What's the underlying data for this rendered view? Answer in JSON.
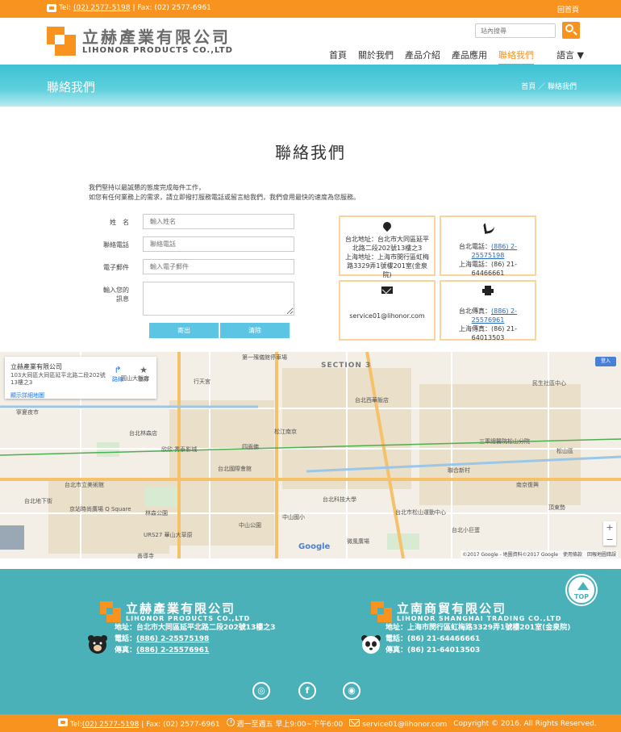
{
  "topbar": {
    "tel_label": "Tel:",
    "tel": "(02) 2577-5198",
    "fax": "| Fax: (02) 2577-6961",
    "home_link": "回首頁"
  },
  "header": {
    "logo_cn": "立赫產業有限公司",
    "logo_en": "LIHONOR PRODUCTS CO.,LTD",
    "search_placeholder": "站內搜尋",
    "nav": [
      "首頁",
      "關於我們",
      "產品介紹",
      "產品應用",
      "聯絡我們"
    ],
    "active_nav": "聯絡我們",
    "lang": "語言 ▼"
  },
  "banner": {
    "title": "聯絡我們",
    "breadcrumb": "首頁 ／ 聯絡我們"
  },
  "main": {
    "heading": "聯絡我們",
    "intro_line1": "我們堅持以最誠懇的態度完成每件工作，",
    "intro_line2": "如您有任何業務上的需求，請立即撥打服務電話或留言給我們，我們會用最快的速度為您服務。"
  },
  "form": {
    "name_label": "姓　名",
    "name_placeholder": "輸入姓名",
    "phone_label": "聯絡電話",
    "phone_placeholder": "聯絡電話",
    "email_label": "電子郵件",
    "email_placeholder": "輸入電子郵件",
    "message_label_1": "輸入您的",
    "message_label_2": "訊息",
    "submit_label": "寄出",
    "clear_label": "清除"
  },
  "info": {
    "address_1": "台北地址：台北市大同區延平北路二段202號13樓之3",
    "address_2": "上海地址：上海市閔行區虹梅路3329弄1號樓201室(金泉院)",
    "phone_taipei_label": "台北電話：",
    "phone_taipei": "(886) 2-25575198",
    "phone_shanghai": "上海電話：(86) 21-64466661",
    "email": "service01@lihonor.com",
    "fax_taipei_label": "台北傳真：",
    "fax_taipei": "(886) 2-25576961",
    "fax_shanghai": "上海傳真：(86) 21-64013503"
  },
  "map": {
    "place_name": "立赫產業有限公司",
    "place_address": "103大同區大同區延平北路二段202號13樓之3",
    "directions": "路線",
    "save": "儲存",
    "larger_map": "顯示詳細地圖",
    "section": "SECTION 3",
    "badge": "登入",
    "copyright": "©2017 Google - 地圖資料©2017 Google　使用條款　回報地圖錯誤",
    "labels": [
      "第一殯儀館停車場",
      "台北西華飯店",
      "民生社區中心",
      "松山區",
      "聯合新村",
      "台北市立美術館",
      "圓山大飯店",
      "台北林森店",
      "欣欣·秀泰影城",
      "四面佛",
      "松江南京",
      "台北國際會館",
      "林森公園",
      "中山國小",
      "京站時尚廣場 Q Square",
      "URS27 華山大草原",
      "善導寺",
      "行天宮",
      "寧夏夜市",
      "台北小巨蛋",
      "微風廣場",
      "頂東勢",
      "三軍總醫院松山分院",
      "台北市松山運動中心",
      "台北科技大學",
      "中山公園",
      "南京復興",
      "台北地下街"
    ]
  },
  "footer": {
    "top_label": "TOP",
    "company1_cn": "立赫產業有限公司",
    "company1_en": "LIHONOR PRODUCTS CO.,LTD",
    "company1_address": "地址：台北市大同區延平北路二段202號13樓之3",
    "company1_phone_label": "電話：",
    "company1_phone": "(886) 2-25575198",
    "company1_fax_label": "傳真：",
    "company1_fax": "(886) 2-25576961",
    "company2_cn": "立南商貿有限公司",
    "company2_en": "LIHONOR SHANGHAI TRADING CO.,LTD",
    "company2_address": "地址：上海市閔行區虹梅路3329弄1號樓201室(金泉院)",
    "company2_phone": "電話：(86) 21-64466661",
    "company2_fax": "傳真：(86) 21-64013503",
    "social_icons": [
      "wechat-icon",
      "facebook-icon",
      "line-icon"
    ]
  },
  "bottombar": {
    "tel_label": "Tel:",
    "tel": "(02) 2577-5198",
    "fax": "| Fax: (02) 2577-6961",
    "hours": "週一至週五 早上9:00~下午6:00",
    "email": "service01@lihonor.com",
    "copyright": "Copyright © 2016. All Rights Reserved."
  },
  "colors": {
    "orange": "#f7931e",
    "teal": "#4bb1b9",
    "cyan": "#3ec1d3",
    "button_blue": "#5bc5e3"
  }
}
